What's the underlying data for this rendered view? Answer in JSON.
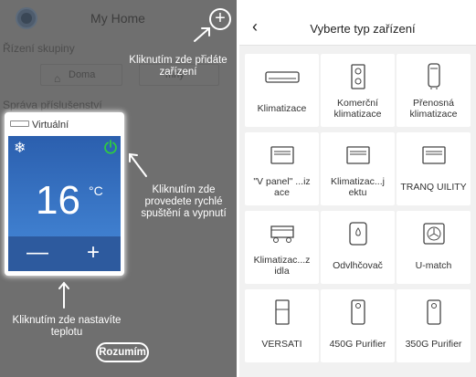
{
  "left": {
    "home_title": "My Home",
    "section_group": "Řízení skupiny",
    "group_home_label": "Doma",
    "group_other_label": "mny",
    "section_accessories": "Správa příslušenství",
    "hint_add": "Kliknutím zde přidáte zařízení",
    "device_name": "Virtuální",
    "temperature": "16",
    "temperature_unit": "°C",
    "minus_label": "—",
    "plus_label": "+",
    "hint_power": "Kliknutím zde provedete rychlé spuštění a vypnutí",
    "hint_temp": "Kliknutím zde nastavíte teplotu",
    "confirm_label": "Rozumím",
    "colors": {
      "overlay": "#6f6f6f",
      "device_blue": "#3f7fcf",
      "power_green": "#2ecc40"
    }
  },
  "right": {
    "back_icon": "chevron-left-icon",
    "title": "Vyberte typ zařízení",
    "tiles": [
      {
        "label": "Klimatizace",
        "icon": "split-ac-icon"
      },
      {
        "label": "Komerční klimatizace",
        "icon": "commercial-ac-icon"
      },
      {
        "label": "Přenosná klimatizace",
        "icon": "portable-ac-icon"
      },
      {
        "label": "\"V panel\" ...iz ace",
        "icon": "panel-ac-icon"
      },
      {
        "label": "Klimatizac...j ektu",
        "icon": "project-ac-icon"
      },
      {
        "label": "TRANQ UILITY",
        "icon": "tranquility-icon"
      },
      {
        "label": "Klimatizac...z idla",
        "icon": "vehicle-ac-icon"
      },
      {
        "label": "Odvlhčovač",
        "icon": "dehumidifier-icon"
      },
      {
        "label": "U-match",
        "icon": "u-match-icon"
      },
      {
        "label": "VERSATI",
        "icon": "versati-icon"
      },
      {
        "label": "450G Purifier",
        "icon": "purifier-icon"
      },
      {
        "label": "350G Purifier",
        "icon": "purifier-icon"
      }
    ]
  }
}
